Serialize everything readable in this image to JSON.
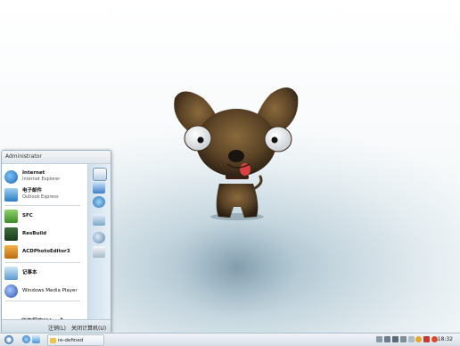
{
  "start_menu": {
    "user": "Administrator",
    "pinned": [
      {
        "title": "Internet",
        "subtitle": "Internet Explorer"
      },
      {
        "title": "电子邮件",
        "subtitle": "Outlook Express"
      }
    ],
    "recent": [
      "SFC",
      "ResBuild",
      "ACDPhotoEditor3",
      "记事本",
      "Windows Media Player"
    ],
    "all_programs": "所有程序(P)",
    "logoff": "注销(L)",
    "shutdown": "关闭计算机(U)"
  },
  "taskbar": {
    "task": "re-defined",
    "clock": "18:32"
  },
  "colors": {
    "accent": "#2f6fb5",
    "taskbar": "#dfe7ed"
  }
}
